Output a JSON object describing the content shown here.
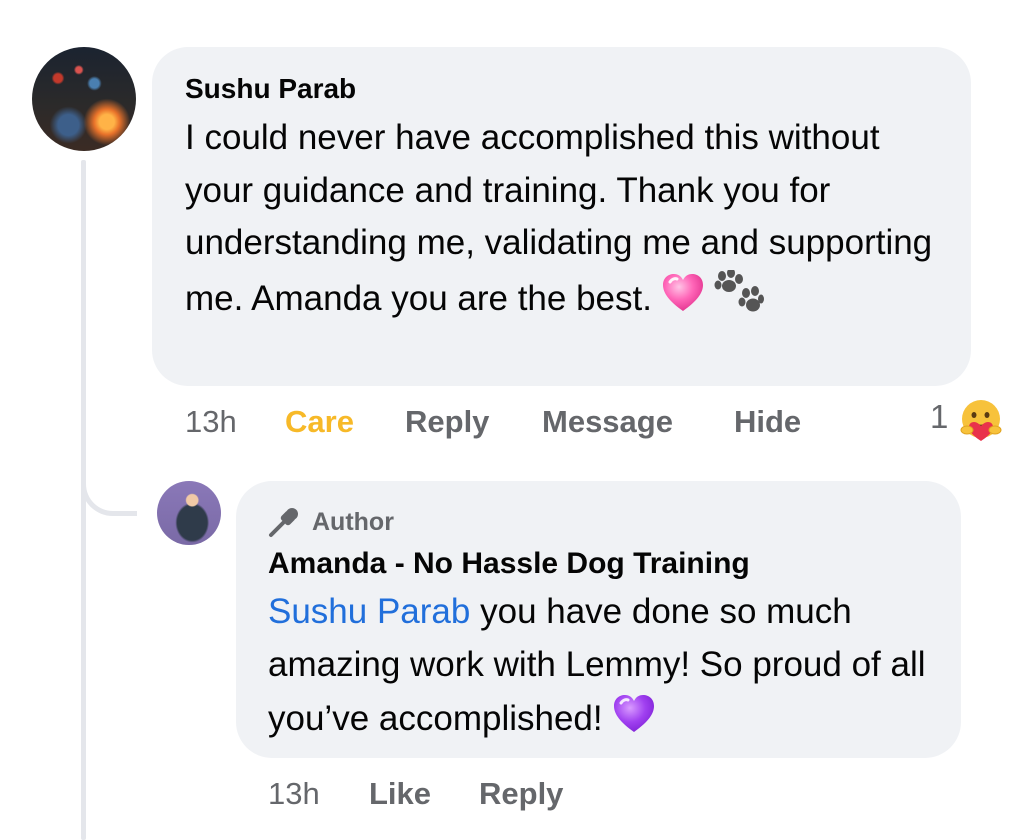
{
  "comment": {
    "author": "Sushu Parab",
    "text": "I could never have accomplished this without your guidance and training. Thank you for understanding me, validating me and supporting me. Amanda you are the best.",
    "emojis": [
      "pink-heart-emoji",
      "paw-prints-emoji"
    ],
    "time": "13h",
    "actions": {
      "care": "Care",
      "reply": "Reply",
      "message": "Message",
      "hide": "Hide"
    },
    "reaction_count": "1",
    "reaction_icon": "care-reaction-icon"
  },
  "reply": {
    "badge": "Author",
    "author": "Amanda - No Hassle Dog Training",
    "mention": "Sushu Parab",
    "text": " you have done so much amazing work with Lemmy! So proud of all you’ve accomplished!",
    "emojis": [
      "purple-heart-emoji"
    ],
    "time": "13h",
    "actions": {
      "like": "Like",
      "reply": "Reply"
    }
  },
  "colors": {
    "bubble": "#f0f2f5",
    "secondary_text": "#65676b",
    "care": "#f7b928",
    "mention": "#216fdb",
    "thread_line": "#e4e6eb"
  }
}
